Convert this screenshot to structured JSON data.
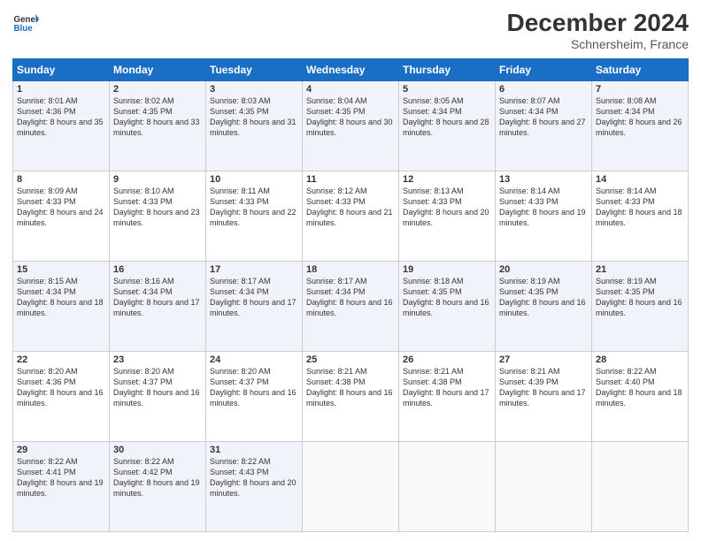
{
  "header": {
    "logo_line1": "General",
    "logo_line2": "Blue",
    "month_year": "December 2024",
    "location": "Schnersheim, France"
  },
  "days_of_week": [
    "Sunday",
    "Monday",
    "Tuesday",
    "Wednesday",
    "Thursday",
    "Friday",
    "Saturday"
  ],
  "weeks": [
    [
      {
        "day": "1",
        "sunrise": "Sunrise: 8:01 AM",
        "sunset": "Sunset: 4:36 PM",
        "daylight": "Daylight: 8 hours and 35 minutes."
      },
      {
        "day": "2",
        "sunrise": "Sunrise: 8:02 AM",
        "sunset": "Sunset: 4:35 PM",
        "daylight": "Daylight: 8 hours and 33 minutes."
      },
      {
        "day": "3",
        "sunrise": "Sunrise: 8:03 AM",
        "sunset": "Sunset: 4:35 PM",
        "daylight": "Daylight: 8 hours and 31 minutes."
      },
      {
        "day": "4",
        "sunrise": "Sunrise: 8:04 AM",
        "sunset": "Sunset: 4:35 PM",
        "daylight": "Daylight: 8 hours and 30 minutes."
      },
      {
        "day": "5",
        "sunrise": "Sunrise: 8:05 AM",
        "sunset": "Sunset: 4:34 PM",
        "daylight": "Daylight: 8 hours and 28 minutes."
      },
      {
        "day": "6",
        "sunrise": "Sunrise: 8:07 AM",
        "sunset": "Sunset: 4:34 PM",
        "daylight": "Daylight: 8 hours and 27 minutes."
      },
      {
        "day": "7",
        "sunrise": "Sunrise: 8:08 AM",
        "sunset": "Sunset: 4:34 PM",
        "daylight": "Daylight: 8 hours and 26 minutes."
      }
    ],
    [
      {
        "day": "8",
        "sunrise": "Sunrise: 8:09 AM",
        "sunset": "Sunset: 4:33 PM",
        "daylight": "Daylight: 8 hours and 24 minutes."
      },
      {
        "day": "9",
        "sunrise": "Sunrise: 8:10 AM",
        "sunset": "Sunset: 4:33 PM",
        "daylight": "Daylight: 8 hours and 23 minutes."
      },
      {
        "day": "10",
        "sunrise": "Sunrise: 8:11 AM",
        "sunset": "Sunset: 4:33 PM",
        "daylight": "Daylight: 8 hours and 22 minutes."
      },
      {
        "day": "11",
        "sunrise": "Sunrise: 8:12 AM",
        "sunset": "Sunset: 4:33 PM",
        "daylight": "Daylight: 8 hours and 21 minutes."
      },
      {
        "day": "12",
        "sunrise": "Sunrise: 8:13 AM",
        "sunset": "Sunset: 4:33 PM",
        "daylight": "Daylight: 8 hours and 20 minutes."
      },
      {
        "day": "13",
        "sunrise": "Sunrise: 8:14 AM",
        "sunset": "Sunset: 4:33 PM",
        "daylight": "Daylight: 8 hours and 19 minutes."
      },
      {
        "day": "14",
        "sunrise": "Sunrise: 8:14 AM",
        "sunset": "Sunset: 4:33 PM",
        "daylight": "Daylight: 8 hours and 18 minutes."
      }
    ],
    [
      {
        "day": "15",
        "sunrise": "Sunrise: 8:15 AM",
        "sunset": "Sunset: 4:34 PM",
        "daylight": "Daylight: 8 hours and 18 minutes."
      },
      {
        "day": "16",
        "sunrise": "Sunrise: 8:16 AM",
        "sunset": "Sunset: 4:34 PM",
        "daylight": "Daylight: 8 hours and 17 minutes."
      },
      {
        "day": "17",
        "sunrise": "Sunrise: 8:17 AM",
        "sunset": "Sunset: 4:34 PM",
        "daylight": "Daylight: 8 hours and 17 minutes."
      },
      {
        "day": "18",
        "sunrise": "Sunrise: 8:17 AM",
        "sunset": "Sunset: 4:34 PM",
        "daylight": "Daylight: 8 hours and 16 minutes."
      },
      {
        "day": "19",
        "sunrise": "Sunrise: 8:18 AM",
        "sunset": "Sunset: 4:35 PM",
        "daylight": "Daylight: 8 hours and 16 minutes."
      },
      {
        "day": "20",
        "sunrise": "Sunrise: 8:19 AM",
        "sunset": "Sunset: 4:35 PM",
        "daylight": "Daylight: 8 hours and 16 minutes."
      },
      {
        "day": "21",
        "sunrise": "Sunrise: 8:19 AM",
        "sunset": "Sunset: 4:35 PM",
        "daylight": "Daylight: 8 hours and 16 minutes."
      }
    ],
    [
      {
        "day": "22",
        "sunrise": "Sunrise: 8:20 AM",
        "sunset": "Sunset: 4:36 PM",
        "daylight": "Daylight: 8 hours and 16 minutes."
      },
      {
        "day": "23",
        "sunrise": "Sunrise: 8:20 AM",
        "sunset": "Sunset: 4:37 PM",
        "daylight": "Daylight: 8 hours and 16 minutes."
      },
      {
        "day": "24",
        "sunrise": "Sunrise: 8:20 AM",
        "sunset": "Sunset: 4:37 PM",
        "daylight": "Daylight: 8 hours and 16 minutes."
      },
      {
        "day": "25",
        "sunrise": "Sunrise: 8:21 AM",
        "sunset": "Sunset: 4:38 PM",
        "daylight": "Daylight: 8 hours and 16 minutes."
      },
      {
        "day": "26",
        "sunrise": "Sunrise: 8:21 AM",
        "sunset": "Sunset: 4:38 PM",
        "daylight": "Daylight: 8 hours and 17 minutes."
      },
      {
        "day": "27",
        "sunrise": "Sunrise: 8:21 AM",
        "sunset": "Sunset: 4:39 PM",
        "daylight": "Daylight: 8 hours and 17 minutes."
      },
      {
        "day": "28",
        "sunrise": "Sunrise: 8:22 AM",
        "sunset": "Sunset: 4:40 PM",
        "daylight": "Daylight: 8 hours and 18 minutes."
      }
    ],
    [
      {
        "day": "29",
        "sunrise": "Sunrise: 8:22 AM",
        "sunset": "Sunset: 4:41 PM",
        "daylight": "Daylight: 8 hours and 19 minutes."
      },
      {
        "day": "30",
        "sunrise": "Sunrise: 8:22 AM",
        "sunset": "Sunset: 4:42 PM",
        "daylight": "Daylight: 8 hours and 19 minutes."
      },
      {
        "day": "31",
        "sunrise": "Sunrise: 8:22 AM",
        "sunset": "Sunset: 4:43 PM",
        "daylight": "Daylight: 8 hours and 20 minutes."
      },
      null,
      null,
      null,
      null
    ]
  ]
}
